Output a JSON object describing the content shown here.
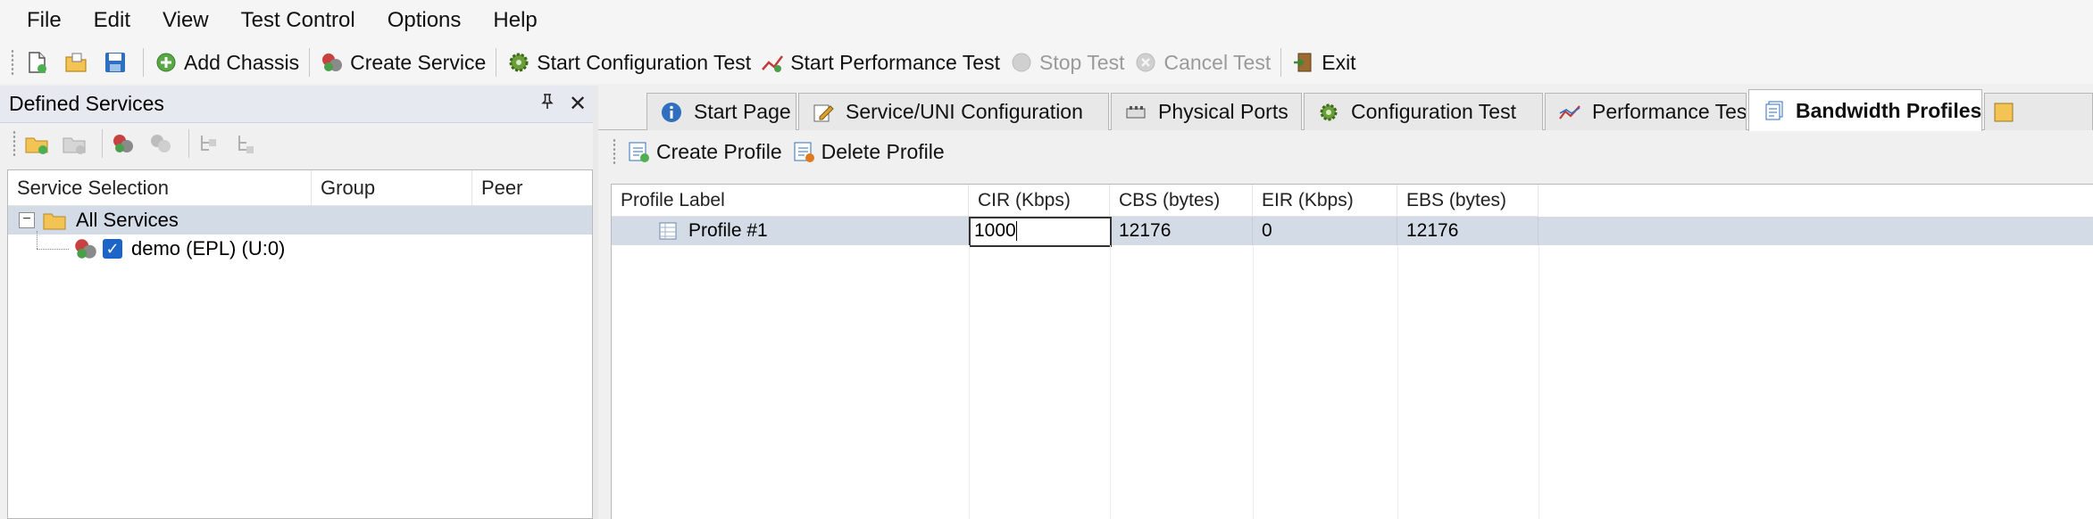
{
  "menu": [
    "File",
    "Edit",
    "View",
    "Test Control",
    "Options",
    "Help"
  ],
  "toolbar": {
    "add_chassis": "Add Chassis",
    "create_service": "Create Service",
    "start_config_test": "Start Configuration Test",
    "start_perf_test": "Start Performance Test",
    "stop_test": "Stop Test",
    "cancel_test": "Cancel Test",
    "exit": "Exit"
  },
  "left_panel": {
    "title": "Defined Services",
    "pin_glyph": "📌",
    "close_glyph": "✕",
    "columns": [
      "Service Selection",
      "Group",
      "Peer"
    ],
    "tree": {
      "root_label": "All Services",
      "root_expander": "−",
      "child_label": "demo (EPL) (U:0)",
      "child_checked": "✓"
    }
  },
  "tabs": [
    {
      "label": "Start Page",
      "icon": "info-icon"
    },
    {
      "label": "Service/UNI Configuration",
      "icon": "edit-icon"
    },
    {
      "label": "Physical Ports",
      "icon": "ports-icon"
    },
    {
      "label": "Configuration Test",
      "icon": "gear-icon"
    },
    {
      "label": "Performance Test",
      "icon": "chart-icon"
    },
    {
      "label": "Bandwidth Profiles",
      "icon": "profiles-icon"
    }
  ],
  "active_tab": "Bandwidth Profiles",
  "profile_toolbar": {
    "create_profile": "Create Profile",
    "delete_profile": "Delete Profile"
  },
  "grid": {
    "columns": [
      "Profile Label",
      "CIR (Kbps)",
      "CBS (bytes)",
      "EIR (Kbps)",
      "EBS (bytes)"
    ],
    "rows": [
      {
        "label": "Profile #1",
        "cir": "1000",
        "cbs": "12176",
        "eir": "0",
        "ebs": "12176"
      }
    ]
  },
  "colors": {
    "selection": "#d3dbe6",
    "checkbox": "#1c64c8"
  }
}
